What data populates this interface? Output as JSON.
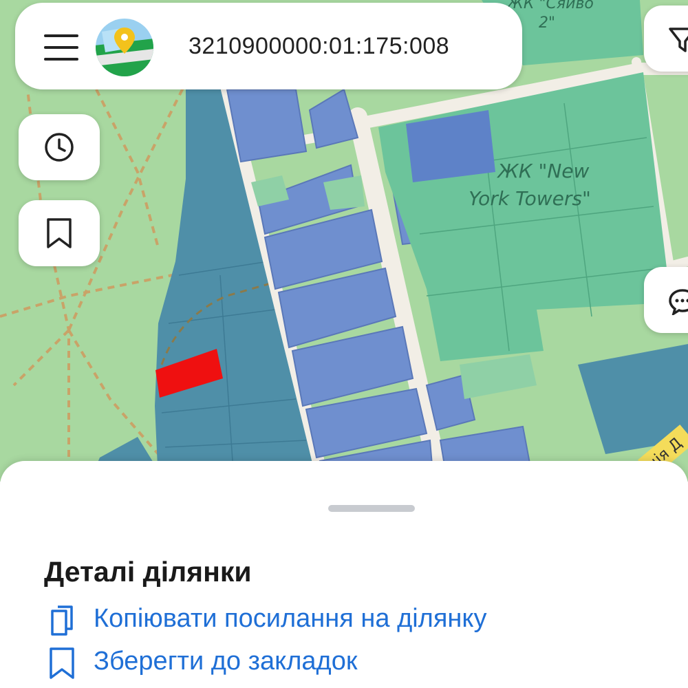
{
  "search": {
    "cadastral_number": "3210900000:01:175:008"
  },
  "map": {
    "labels": {
      "complex_main_line1": "ЖК \"New",
      "complex_main_line2": "York Towers\"",
      "complex_top": "ЖК \"Сяйво",
      "complex_top_line2": "2\"",
      "street_fragment": "ція Д"
    },
    "colors": {
      "forest": "#a8d8a0",
      "parcel_blue": "#6f8fcf",
      "parcel_teal": "#4f8fa8",
      "parcel_green": "#6cc49b",
      "selected_parcel": "#ef1010",
      "road": "#f2eee6"
    }
  },
  "controls": {
    "menu_icon": "hamburger-icon",
    "history_icon": "clock-icon",
    "bookmarks_icon": "bookmark-icon",
    "filter_icon": "filter-icon",
    "chat_icon": "chat-icon"
  },
  "sheet": {
    "title": "Деталі ділянки",
    "actions": [
      {
        "label": "Копіювати посилання на ділянку",
        "icon": "copy-icon"
      },
      {
        "label": "Зберегти до закладок",
        "icon": "bookmark-icon"
      }
    ]
  }
}
